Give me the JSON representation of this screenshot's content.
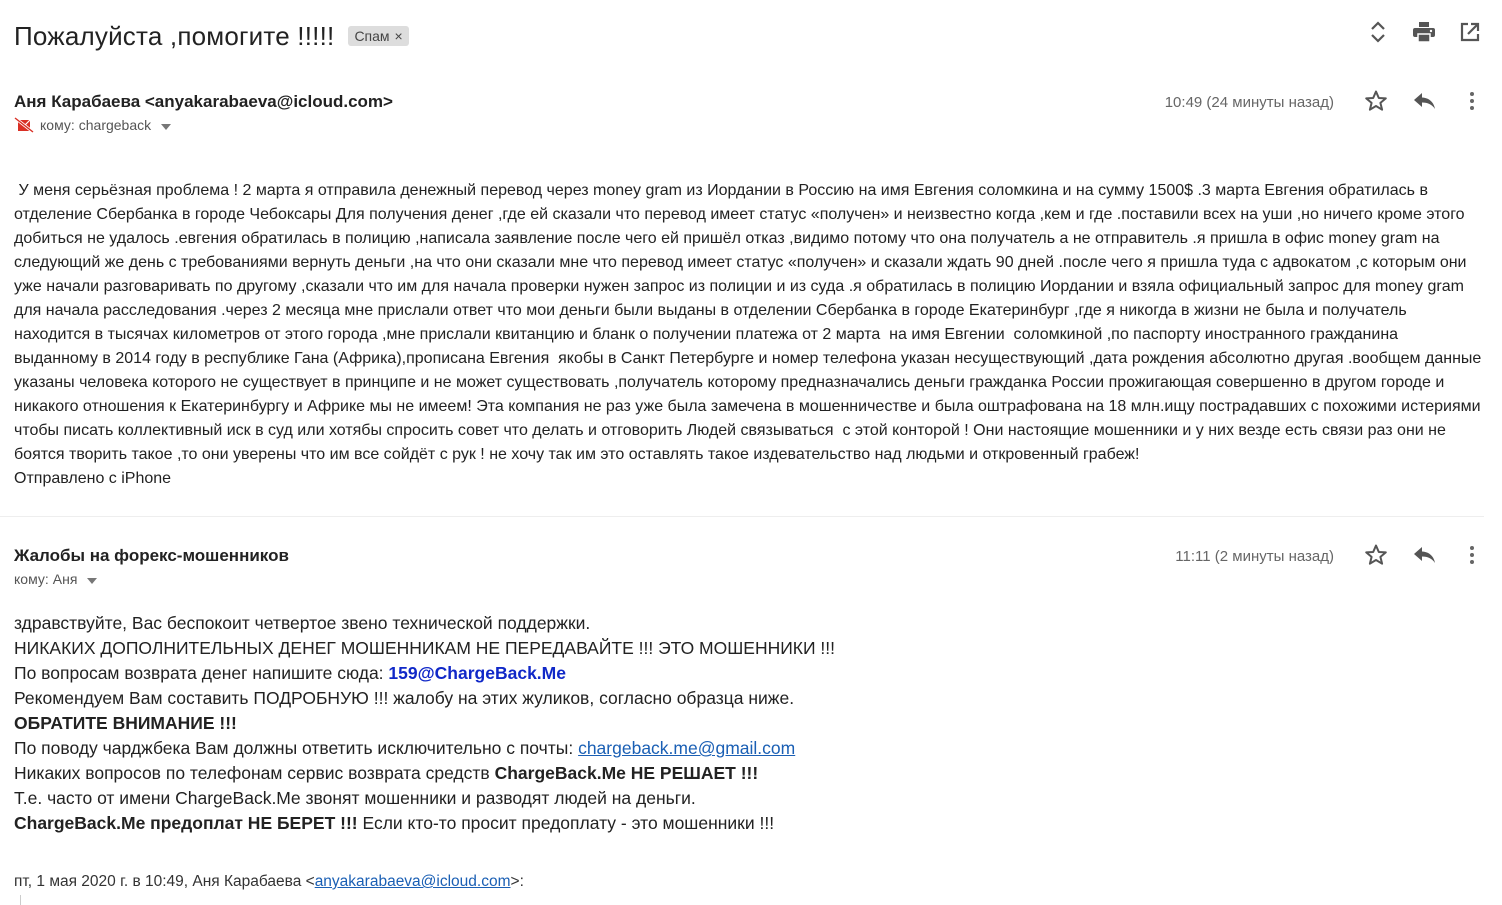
{
  "thread": {
    "subject": "Пожалуйста ,помогите !!!!!",
    "label": "Спам",
    "label_remove": "×"
  },
  "top_actions": [
    "expand-all-icon",
    "print-icon",
    "open-in-new-window-icon"
  ],
  "message1": {
    "sender": "Аня Карабаева <anyakarabaeva@icloud.com>",
    "to_prefix": "кому: ",
    "to": "chargeback",
    "time": "10:49 (24 минуты назад)",
    "body": " У меня серьёзная проблема ! 2 марта я отправила денежный перевод через money gram из Иордании в Россию на имя Евгения соломкина и на сумму 1500$ .3 марта Евгения обратилась в отделение Сбербанка в городе Чебоксары Для получения денег ,где ей сказали что перевод имеет статус «получен» и неизвестно когда ,кем и где .поставили всех на уши ,но ничего кроме этого добиться не удалось .евгения обратилась в полицию ,написала заявление после чего ей пришёл отказ ,видимо потому что она получатель а не отправитель .я пришла в офис money gram на следующий же день с требованиями вернуть деньги ,на что они сказали мне что перевод имеет статус «получен» и сказали ждать 90 дней .после чего я пришла туда с адвокатом ,с которым они уже начали разговаривать по другому ,сказали что им для начала проверки нужен запрос из полиции и из суда .я обратилась в полицию Иордании и взяла официальный запрос для money gram для начала расследования .через 2 месяца мне прислали ответ что мои деньги были выданы в отделении Сбербанка в городе Екатеринбург ,где я никогда в жизни не была и получатель находится в тысячах километров от этого города ,мне прислали квитанцию и бланк о получении платежа от 2 марта  на имя Евгении  соломкиной ,по паспорту иностранного гражданина выданному в 2014 году в республике Гана (Африка),прописана Евгения  якобы в Санкт Петербурге и номер телефона указан несуществующий ,дата рождения абсолютно другая .вообщем данные указаны человека которого не существует в принципе и не может существовать ,получатель которому предназначались деньги гражданка России прожигающая совершенно в другом городе и никакого отношения к Екатеринбургу и Африке мы не имеем! Эта компания не раз уже была замечена в мошенничестве и была оштрафована на 18 млн.ищу пострадавших с похожими истериями чтобы писать коллективный иск в суд или хотябы спросить совет что делать и отговорить Людей связываться  с этой конторой ! Они настоящие мошенники и у них везде есть связи раз они не боятся творить такое ,то они уверены что им все сойдёт с рук ! не хочу так им это оставлять такое издевательство над людьми и откровенный грабеж!",
    "signature": "Отправлено с iPhone"
  },
  "message2": {
    "sender": "Жалобы на форекс-мошенников",
    "to_prefix": "кому: ",
    "to": "Аня",
    "time": "11:11 (2 минуты назад)",
    "line1": "здравствуйте, Вас беспокоит четвертое звено технической поддержки.",
    "line2": "НИКАКИХ ДОПОЛНИТЕЛЬНЫХ ДЕНЕГ МОШЕННИКАМ НЕ ПЕРЕДАВАЙТЕ !!! ЭТО МОШЕННИКИ !!!",
    "line3_text": "По вопросам возврата денег напишите сюда: ",
    "line3_email": "159@ChargeBack.Me",
    "line4": "Рекомендуем Вам составить ПОДРОБНУЮ !!! жалобу на этих жуликов, согласно образца ниже.",
    "line5": "ОБРАТИТЕ ВНИМАНИЕ !!!",
    "line6_text": "По поводу чарджбека Вам должны ответить исключительно с почты: ",
    "line6_email": "chargeback.me@gmail.com",
    "line7_text": "Никаких вопросов по телефонам сервис возврата средств ",
    "line7_bold": "ChargeBack.Me НЕ РЕШАЕТ !!!",
    "line8": "Т.е. часто от имени ChargeBack.Me звонят мошенники и разводят людей на деньги.",
    "line9_bold": "ChargeBack.Me предоплат НЕ БЕРЕТ !!!",
    "line9_text": " Если кто-то просит предоплату - это мошенники !!!",
    "quote_prefix": "пт, 1 мая 2020 г. в 10:49, Аня Карабаева <",
    "quote_email": "anyakarabaeva@icloud.com",
    "quote_suffix": ">:"
  }
}
